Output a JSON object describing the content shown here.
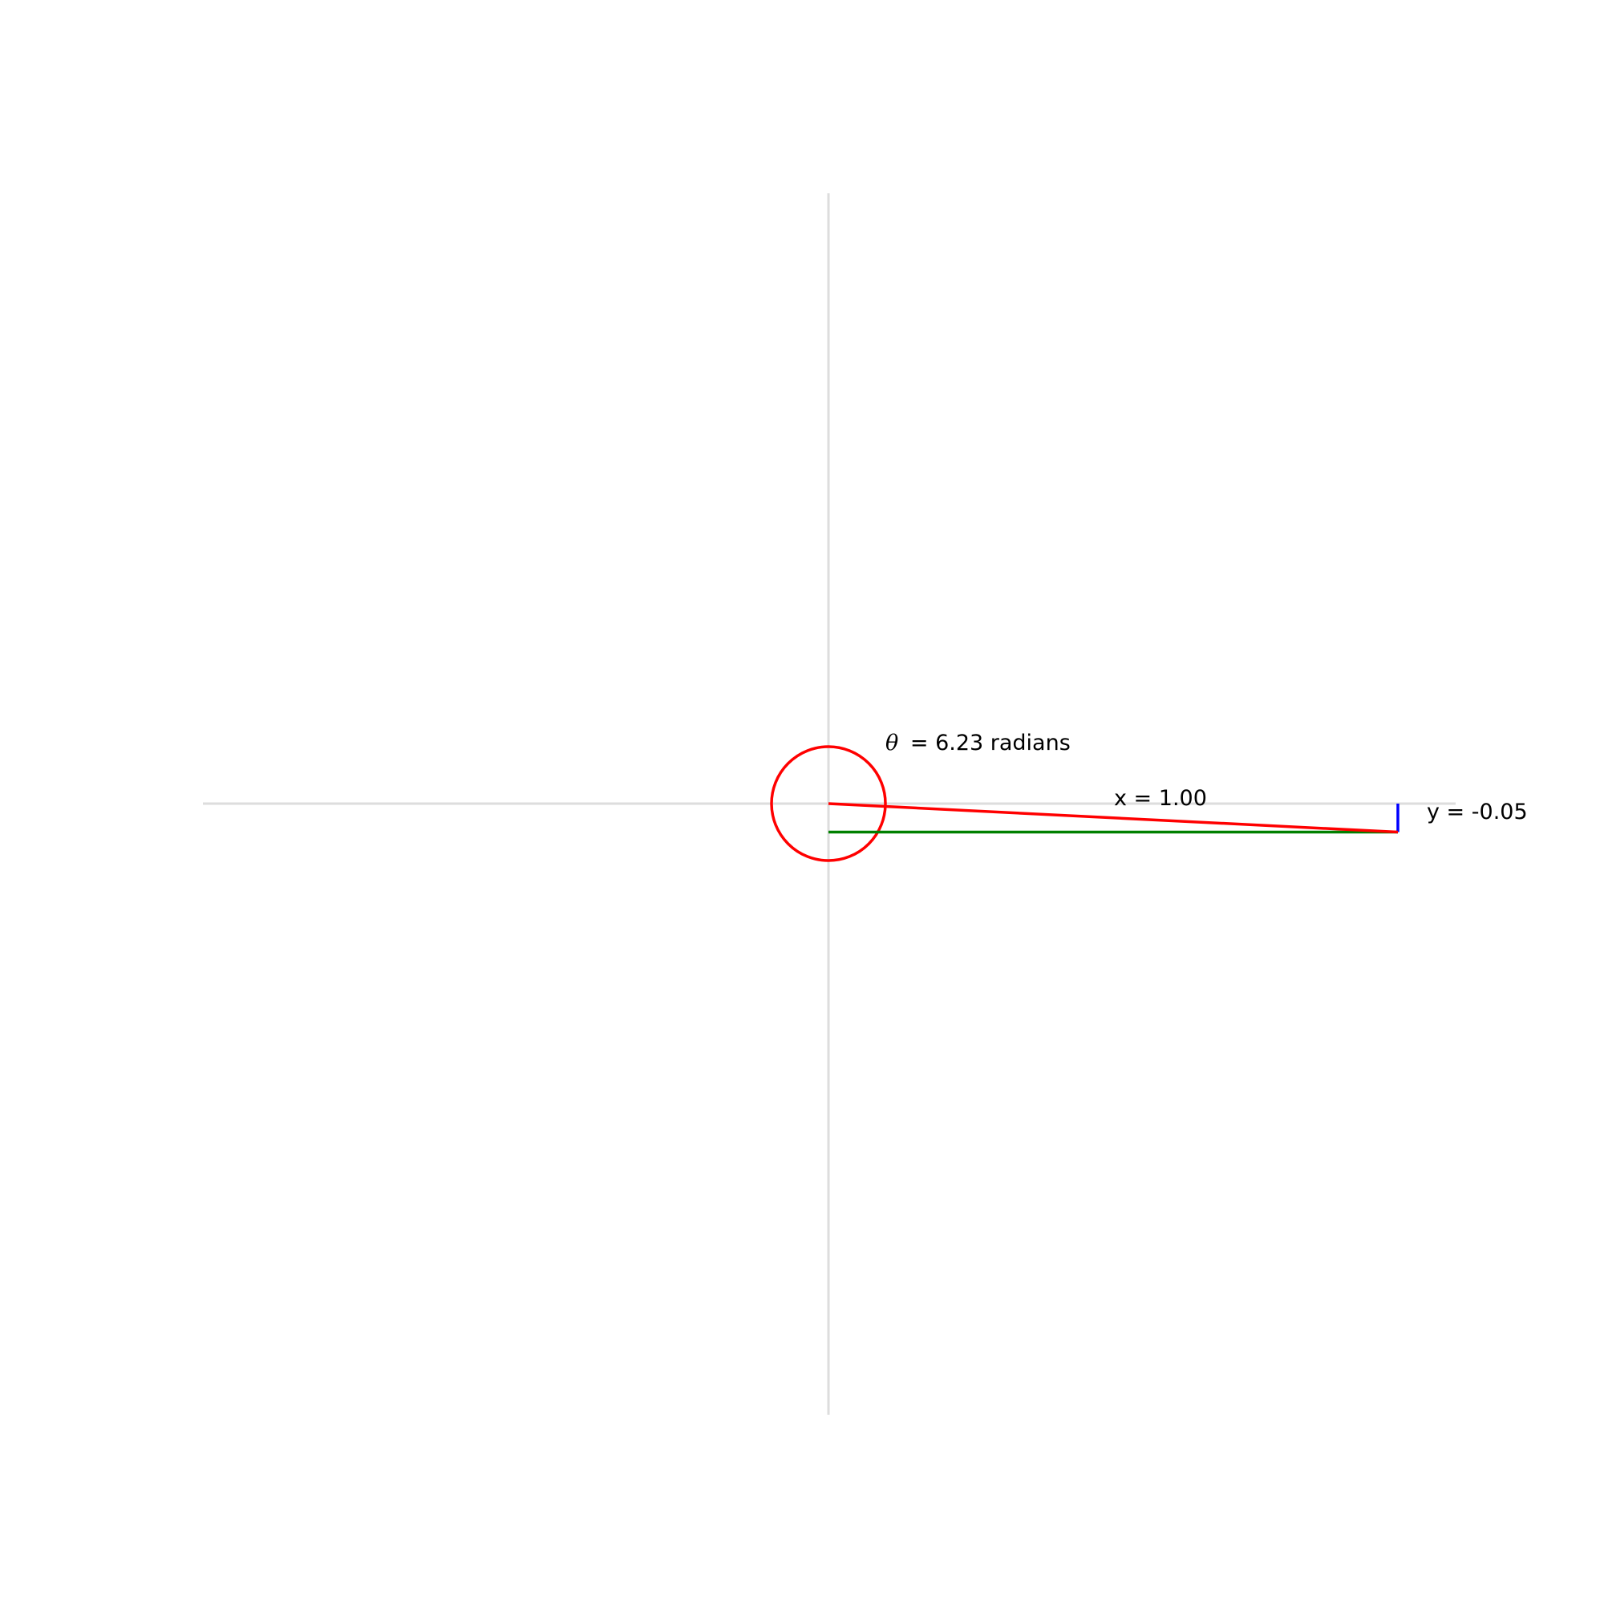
{
  "diagram": {
    "angle_label": {
      "symbol": "θ",
      "text": "= 6.23 radians"
    },
    "x_label": "x = 1.00",
    "y_label": "y = -0.05",
    "values": {
      "theta": 6.23,
      "x": 1.0,
      "y": -0.05,
      "marker_radius": 0.1
    },
    "colors": {
      "axes": "#dddddd",
      "radius_line": "#ff0000",
      "angle_circle": "#ff0000",
      "x_component": "#008000",
      "y_component": "#0000ff",
      "text": "#000000"
    }
  }
}
